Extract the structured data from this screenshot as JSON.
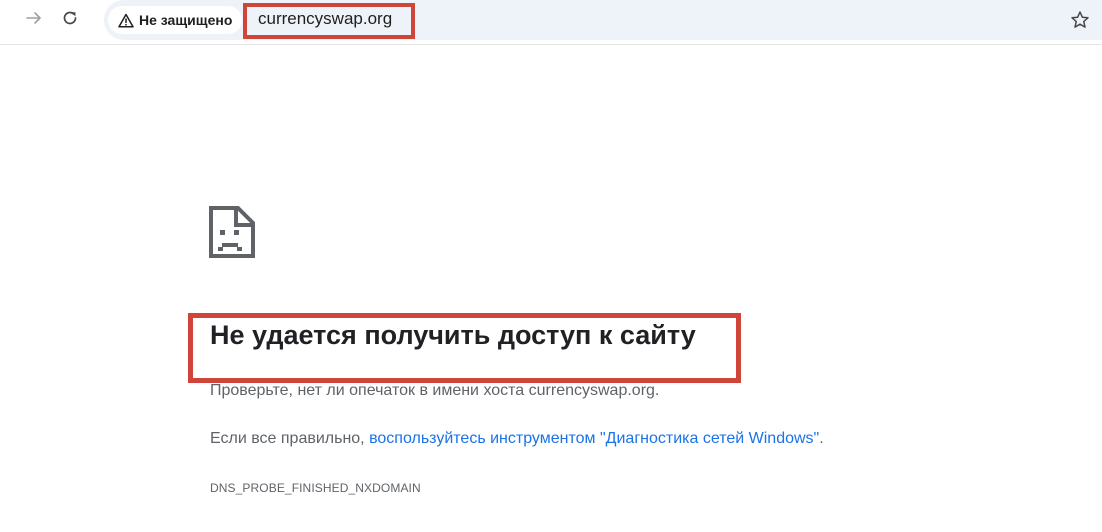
{
  "browser": {
    "forward_icon": "arrow-right-icon",
    "reload_icon": "reload-icon",
    "security_icon": "warning-triangle-icon",
    "security_label": "Не защищено",
    "url": "currencyswap.org",
    "bookmark_icon": "star-outline-icon",
    "highlight_color": "#d0453a"
  },
  "error_page": {
    "icon": "sad-page-icon",
    "title": "Не удается получить доступ к сайту",
    "check_text": "Проверьте, нет ли опечаток в имени хоста currencyswap.org.",
    "if_correct_prefix": "Если все правильно, ",
    "diagnostics_link": "воспользуйтесь инструментом \"Диагностика сетей Windows\"",
    "if_correct_suffix": ".",
    "error_code": "DNS_PROBE_FINISHED_NXDOMAIN",
    "link_color": "#1a73e8",
    "text_color": "#5f6368"
  }
}
